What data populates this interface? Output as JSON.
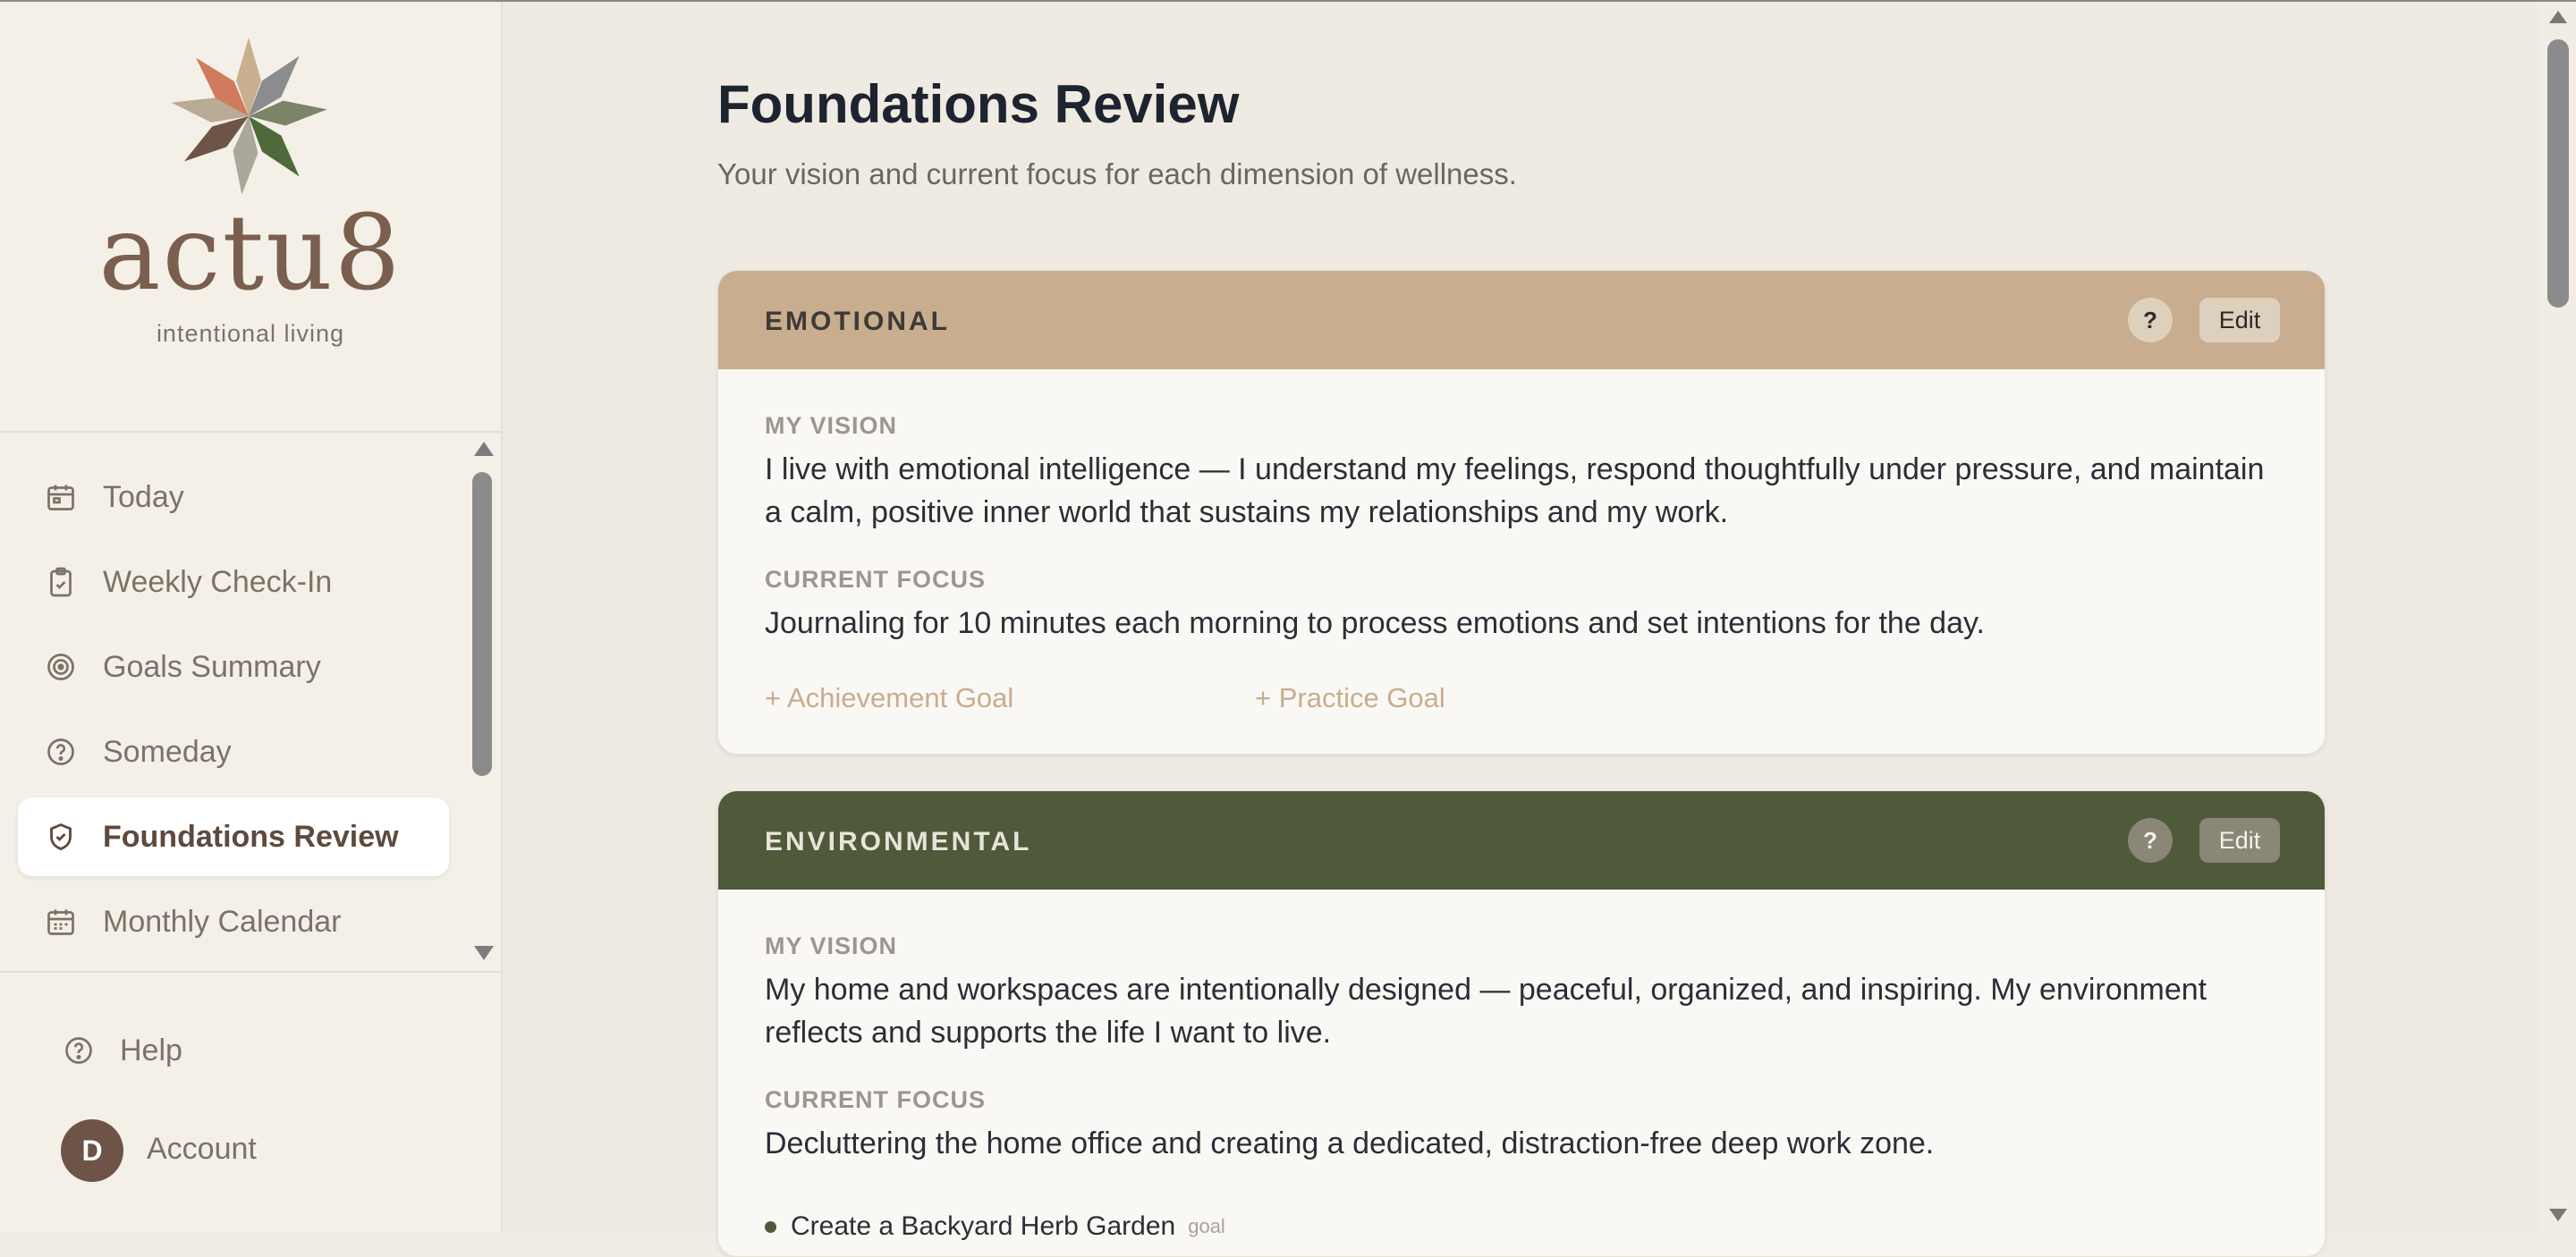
{
  "app": {
    "brand": "actu8",
    "tagline": "intentional living"
  },
  "nav": {
    "items": [
      {
        "label": "Today",
        "icon": "calendar-icon"
      },
      {
        "label": "Weekly Check-In",
        "icon": "clipboard-check-icon"
      },
      {
        "label": "Goals Summary",
        "icon": "target-icon"
      },
      {
        "label": "Someday",
        "icon": "question-circle-icon"
      },
      {
        "label": "Foundations Review",
        "icon": "shield-check-icon",
        "active": true
      },
      {
        "label": "Monthly Calendar",
        "icon": "calendar-grid-icon"
      }
    ],
    "help": "Help",
    "account": "Account",
    "avatar_initial": "D"
  },
  "page": {
    "title": "Foundations Review",
    "subtitle": "Your vision and current focus for each dimension of wellness."
  },
  "colors": {
    "emotional_header": "#c8ae8e",
    "environmental_header": "#4e5a3a",
    "accent_link": "#c8ad8e"
  },
  "cards": [
    {
      "title": "EMOTIONAL",
      "help": "?",
      "edit": "Edit",
      "vision_label": "MY VISION",
      "vision": "I live with emotional intelligence — I understand my feelings, respond thoughtfully under pressure, and maintain a calm, positive inner world that sustains my relationships and my work.",
      "focus_label": "CURRENT FOCUS",
      "focus": "Journaling for 10 minutes each morning to process emotions and set intentions for the day.",
      "add_achievement": "+ Achievement Goal",
      "add_practice": "+ Practice Goal"
    },
    {
      "title": "ENVIRONMENTAL",
      "help": "?",
      "edit": "Edit",
      "vision_label": "MY VISION",
      "vision": "My home and workspaces are intentionally designed — peaceful, organized, and inspiring. My environment reflects and supports the life I want to live.",
      "focus_label": "CURRENT FOCUS",
      "focus": "Decluttering the home office and creating a dedicated, distraction-free deep work zone.",
      "goals": [
        {
          "title": "Create a Backyard Herb Garden",
          "tag": "goal"
        }
      ]
    }
  ]
}
